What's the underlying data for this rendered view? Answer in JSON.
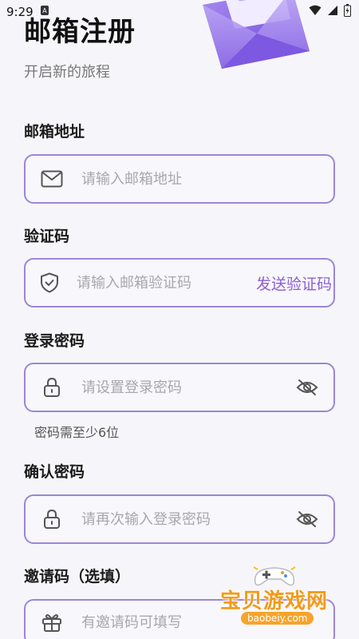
{
  "status_bar": {
    "time": "9:29"
  },
  "header": {
    "title": "邮箱注册",
    "subtitle": "开启新的旅程"
  },
  "fields": {
    "email": {
      "label": "邮箱地址",
      "placeholder": "请输入邮箱地址",
      "icon": "mail-icon"
    },
    "code": {
      "label": "验证码",
      "placeholder": "请输入邮箱验证码",
      "icon": "shield-check-icon",
      "action": "发送验证码"
    },
    "password": {
      "label": "登录密码",
      "placeholder": "请设置登录密码",
      "icon": "lock-icon",
      "hint": "密码需至少6位"
    },
    "confirm": {
      "label": "确认密码",
      "placeholder": "请再次输入登录密码",
      "icon": "lock-icon"
    },
    "invite": {
      "label": "邀请码（选填）",
      "placeholder": "有邀请码可填写",
      "icon": "gift-icon"
    }
  },
  "watermark": {
    "text": "宝贝游戏网",
    "url": "baobeiy.com"
  },
  "colors": {
    "accent": "#8b5fd6",
    "border": "#9b86d6",
    "background": "#f6f6fa",
    "watermark": "#f29b18"
  }
}
